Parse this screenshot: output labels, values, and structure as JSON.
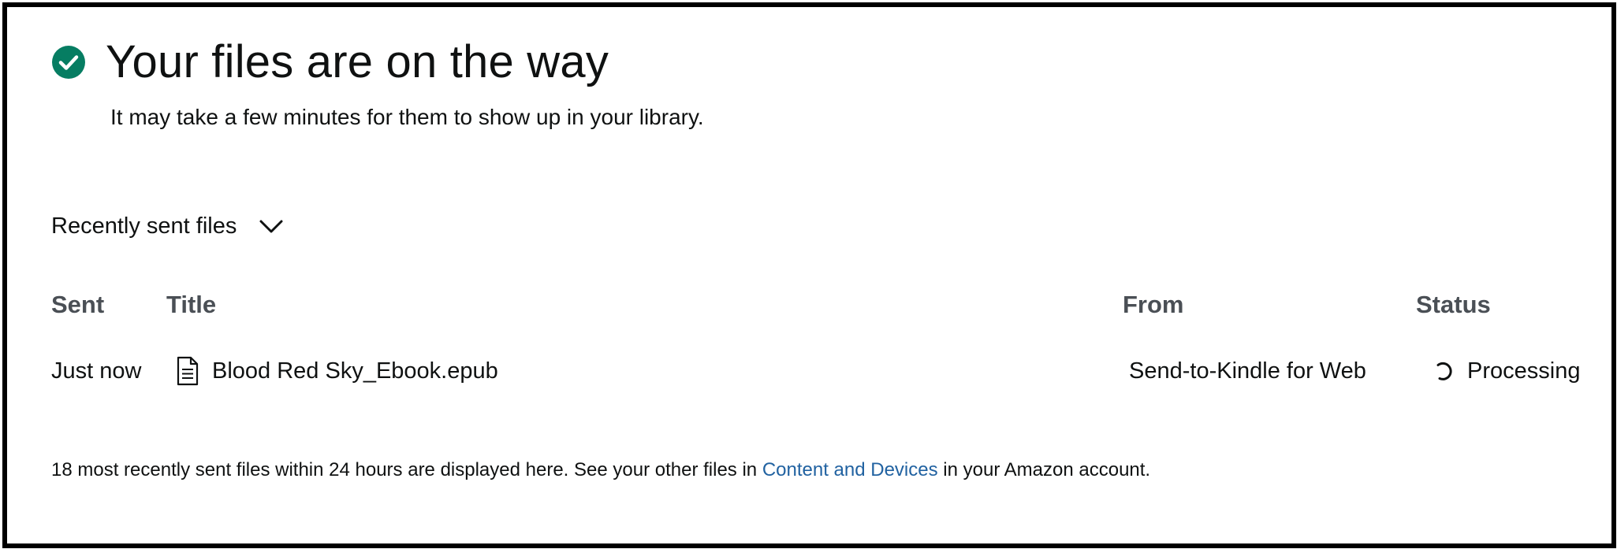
{
  "header": {
    "icon": "check-circle-icon",
    "title": "Your files are on the way",
    "subtitle": "It may take a few minutes for them to show up in your library."
  },
  "recent": {
    "toggle_label": "Recently sent files",
    "toggle_icon": "chevron-down-icon",
    "columns": {
      "sent": "Sent",
      "title": "Title",
      "from": "From",
      "status": "Status"
    },
    "rows": [
      {
        "sent": "Just now",
        "file_icon": "document-icon",
        "title": "Blood Red Sky_Ebook.epub",
        "from": "Send-to-Kindle for Web",
        "status_icon": "spinner-icon",
        "status": "Processing"
      }
    ]
  },
  "footer": {
    "prefix": "18 most recently sent files within 24 hours are displayed here. See your other files in ",
    "link_text": "Content and Devices",
    "suffix": " in your Amazon account."
  },
  "colors": {
    "success": "#067d62",
    "link": "#2162a1",
    "header_text": "#4a4f55",
    "text": "#0f1111"
  }
}
